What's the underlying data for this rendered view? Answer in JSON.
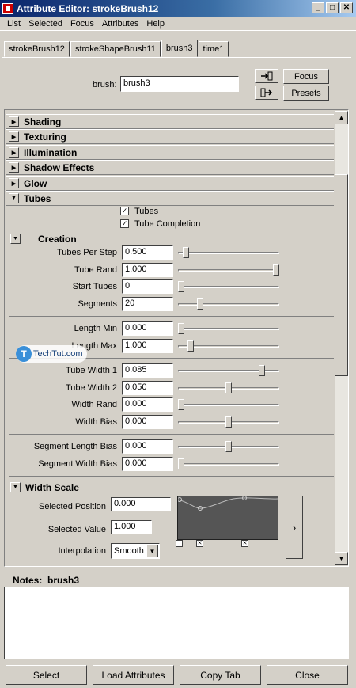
{
  "window": {
    "title": "Attribute Editor: strokeBrush12"
  },
  "menu": [
    "List",
    "Selected",
    "Focus",
    "Attributes",
    "Help"
  ],
  "tabs": [
    "strokeBrush12",
    "strokeShapeBrush11",
    "brush3",
    "time1"
  ],
  "active_tab": "brush3",
  "brush": {
    "label": "brush:",
    "value": "brush3"
  },
  "buttons": {
    "focus": "Focus",
    "presets": "Presets"
  },
  "sections": [
    "Shading",
    "Texturing",
    "Illumination",
    "Shadow Effects",
    "Glow",
    "Tubes"
  ],
  "tubes": {
    "tubes_label": "Tubes",
    "tubes_checked": true,
    "completion_label": "Tube Completion",
    "completion_checked": true
  },
  "creation": {
    "title": "Creation",
    "rows": [
      {
        "label": "Tubes Per Step",
        "value": "0.500",
        "slider": 0.05
      },
      {
        "label": "Tube Rand",
        "value": "1.000",
        "slider": 1.0
      },
      {
        "label": "Start Tubes",
        "value": "0",
        "slider": 0.0
      },
      {
        "label": "Segments",
        "value": "20",
        "slider": 0.2
      },
      {
        "label": "Length Min",
        "value": "0.000",
        "slider": 0.0
      },
      {
        "label": "Length Max",
        "value": "1.000",
        "slider": 0.1
      },
      {
        "label": "Tube Width 1",
        "value": "0.085",
        "slider": 0.85
      },
      {
        "label": "Tube Width 2",
        "value": "0.050",
        "slider": 0.5
      },
      {
        "label": "Width Rand",
        "value": "0.000",
        "slider": 0.0
      },
      {
        "label": "Width Bias",
        "value": "0.000",
        "slider": 0.5
      },
      {
        "label": "Segment Length Bias",
        "value": "0.000",
        "slider": 0.5
      },
      {
        "label": "Segment Width Bias",
        "value": "0.000",
        "slider": 0.0
      }
    ]
  },
  "width_scale": {
    "title": "Width Scale",
    "selected_position_label": "Selected Position",
    "selected_position": "0.000",
    "selected_value_label": "Selected Value",
    "selected_value": "1.000",
    "interpolation_label": "Interpolation",
    "interpolation": "Smooth",
    "expand_symbol": "›"
  },
  "notes": {
    "label": "Notes:",
    "name": "brush3"
  },
  "footer": {
    "select": "Select",
    "load": "Load Attributes",
    "copy": "Copy Tab",
    "close": "Close"
  },
  "watermark": {
    "text": "TechTut.com",
    "letter": "T"
  }
}
